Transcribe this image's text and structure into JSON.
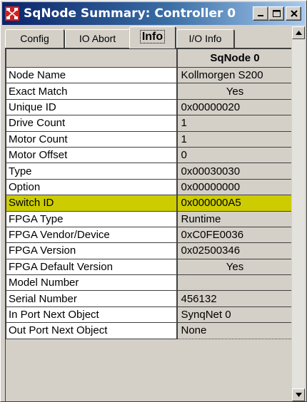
{
  "window": {
    "title": "SqNode Summary: Controller 0",
    "icon": "network-nodes-icon"
  },
  "tabs": [
    {
      "label": "Config",
      "active": false
    },
    {
      "label": "IO Abort",
      "active": false
    },
    {
      "label": "Info",
      "active": true
    },
    {
      "label": "I/O Info",
      "active": false
    }
  ],
  "table": {
    "column_header": "SqNode 0",
    "rows": [
      {
        "label": "Node Name",
        "value": "Kollmorgen S200"
      },
      {
        "label": "Exact Match",
        "value": "Yes"
      },
      {
        "label": "Unique ID",
        "value": "0x00000020"
      },
      {
        "label": "Drive Count",
        "value": "1"
      },
      {
        "label": "Motor Count",
        "value": "1"
      },
      {
        "label": "Motor Offset",
        "value": "0"
      },
      {
        "label": "Type",
        "value": "0x00030030"
      },
      {
        "label": "Option",
        "value": "0x00000000"
      },
      {
        "label": "Switch ID",
        "value": "0x000000A5"
      },
      {
        "label": "FPGA Type",
        "value": "Runtime"
      },
      {
        "label": "FPGA Vendor/Device",
        "value": "0xC0FE0036"
      },
      {
        "label": "FPGA Version",
        "value": "0x02500346"
      },
      {
        "label": "FPGA Default Version",
        "value": "Yes"
      },
      {
        "label": "Model Number",
        "value": ""
      },
      {
        "label": "Serial Number",
        "value": "456132"
      },
      {
        "label": "In Port Next Object",
        "value": "SynqNet 0"
      },
      {
        "label": "Out Port Next Object",
        "value": "None"
      }
    ],
    "highlight_color": "#cccc00"
  }
}
